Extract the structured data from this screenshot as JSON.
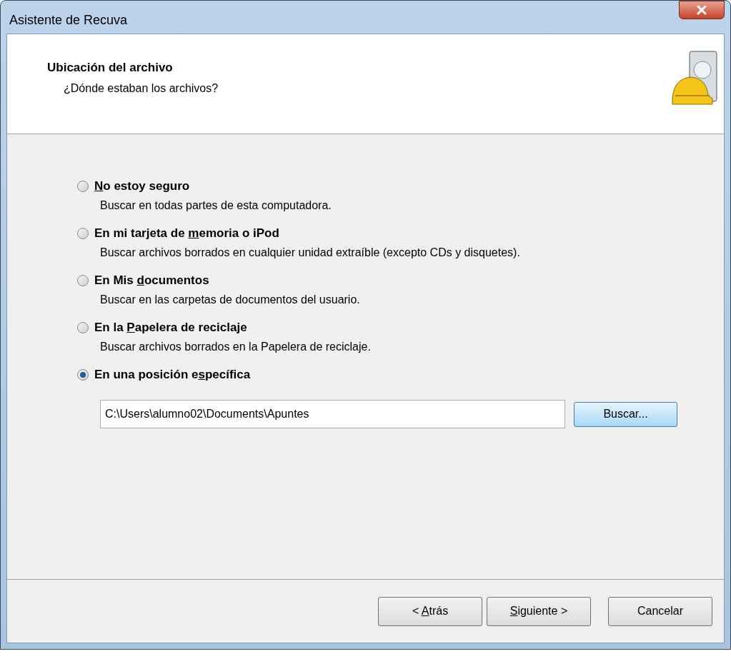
{
  "window": {
    "title": "Asistente de Recuva"
  },
  "header": {
    "title": "Ubicación del archivo",
    "subtitle": "¿Dónde estaban los archivos?"
  },
  "options": [
    {
      "label_key": "N",
      "label_post": "o estoy seguro",
      "description": "Buscar en todas partes de esta computadora.",
      "selected": false
    },
    {
      "label_pre": "En mi tarjeta de ",
      "label_key": "m",
      "label_post": "emoria o iPod",
      "description": "Buscar archivos borrados en cualquier unidad extraíble (excepto CDs y disquetes).",
      "selected": false
    },
    {
      "label_pre": "En Mis ",
      "label_key": "d",
      "label_post": "ocumentos",
      "description": "Buscar en las carpetas de documentos del usuario.",
      "selected": false
    },
    {
      "label_pre": "En la ",
      "label_key": "P",
      "label_post": "apelera de reciclaje",
      "description": "Buscar archivos borrados en la Papelera de reciclaje.",
      "selected": false
    },
    {
      "label_pre": "En una posición e",
      "label_key": "s",
      "label_post": "pecífica",
      "selected": true
    }
  ],
  "path_field": {
    "value": "C:\\Users\\alumno02\\Documents\\Apuntes"
  },
  "browse_button": "Buscar...",
  "buttons": [
    {
      "kind": "back",
      "label_pre": "< ",
      "label_key": "A",
      "label_post": "trás"
    },
    {
      "kind": "next",
      "label_key": "S",
      "label_post": "iguiente >"
    },
    {
      "kind": "cancel",
      "label_post": "Cancelar"
    }
  ]
}
